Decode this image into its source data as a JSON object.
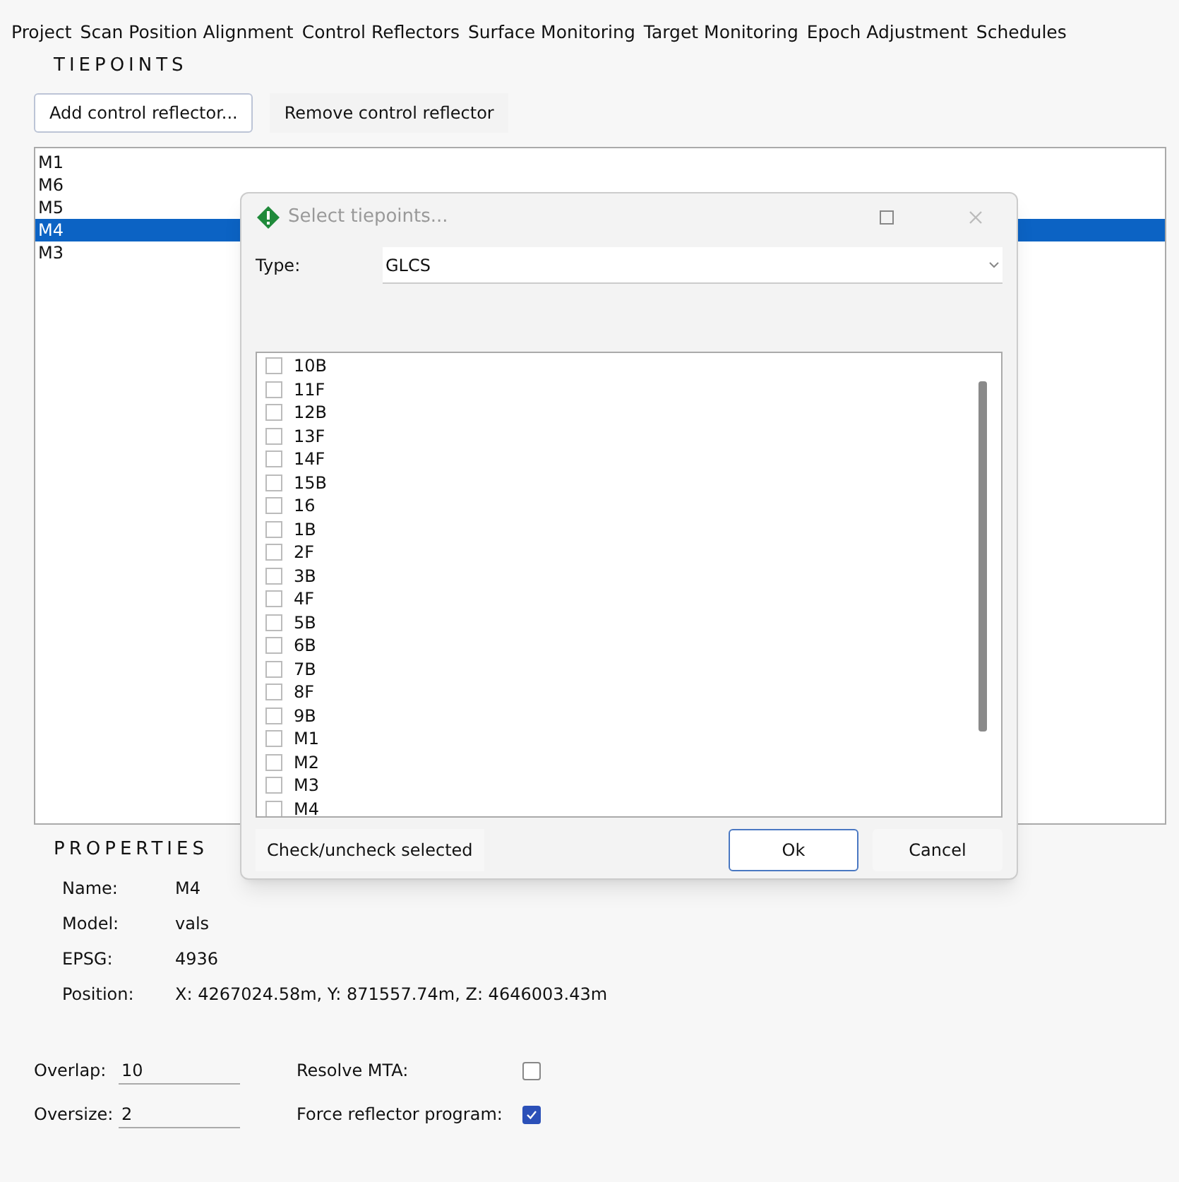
{
  "tabs": [
    {
      "label": "Project"
    },
    {
      "label": "Scan Position Alignment"
    },
    {
      "label": "Control Reflectors"
    },
    {
      "label": "Surface Monitoring"
    },
    {
      "label": "Target Monitoring"
    },
    {
      "label": "Epoch Adjustment"
    },
    {
      "label": "Schedules"
    }
  ],
  "tiepoints": {
    "heading": "TIEPOINTS",
    "buttons": [
      "Add control reflector...",
      "Remove control reflector"
    ],
    "items": [
      {
        "label": "M1",
        "selected": false
      },
      {
        "label": "M6",
        "selected": false
      },
      {
        "label": "M5",
        "selected": false
      },
      {
        "label": "M4",
        "selected": true
      },
      {
        "label": "M3",
        "selected": false
      }
    ]
  },
  "properties": {
    "heading": "PROPERTIES",
    "rows": [
      {
        "label": "Name:",
        "value": "M4"
      },
      {
        "label": "Model:",
        "value": "vals"
      },
      {
        "label": "EPSG:",
        "value": "4936"
      },
      {
        "label": "Position:",
        "value": "X: 4267024.58m, Y: 871557.74m, Z: 4646003.43m"
      }
    ]
  },
  "settings": [
    {
      "label": "Overlap:",
      "value": "10",
      "option": "Resolve MTA:",
      "checked": false
    },
    {
      "label": "Oversize:",
      "value": "2",
      "option": "Force reflector program:",
      "checked": true
    }
  ],
  "dialog": {
    "title": "Select tiepoints...",
    "type_label": "Type:",
    "type_value": "GLCS",
    "items": [
      {
        "label": "10B",
        "checked": false
      },
      {
        "label": "11F",
        "checked": false
      },
      {
        "label": "12B",
        "checked": false
      },
      {
        "label": "13F",
        "checked": false
      },
      {
        "label": "14F",
        "checked": false
      },
      {
        "label": "15B",
        "checked": false
      },
      {
        "label": "16",
        "checked": false
      },
      {
        "label": "1B",
        "checked": false
      },
      {
        "label": "2F",
        "checked": false
      },
      {
        "label": "3B",
        "checked": false
      },
      {
        "label": "4F",
        "checked": false
      },
      {
        "label": "5B",
        "checked": false
      },
      {
        "label": "6B",
        "checked": false
      },
      {
        "label": "7B",
        "checked": false
      },
      {
        "label": "8F",
        "checked": false
      },
      {
        "label": "9B",
        "checked": false
      },
      {
        "label": "M1",
        "checked": false
      },
      {
        "label": "M2",
        "checked": false
      },
      {
        "label": "M3",
        "checked": false
      },
      {
        "label": "M4",
        "checked": false
      }
    ],
    "check_button": "Check/uncheck selected",
    "ok": "Ok",
    "cancel": "Cancel"
  }
}
